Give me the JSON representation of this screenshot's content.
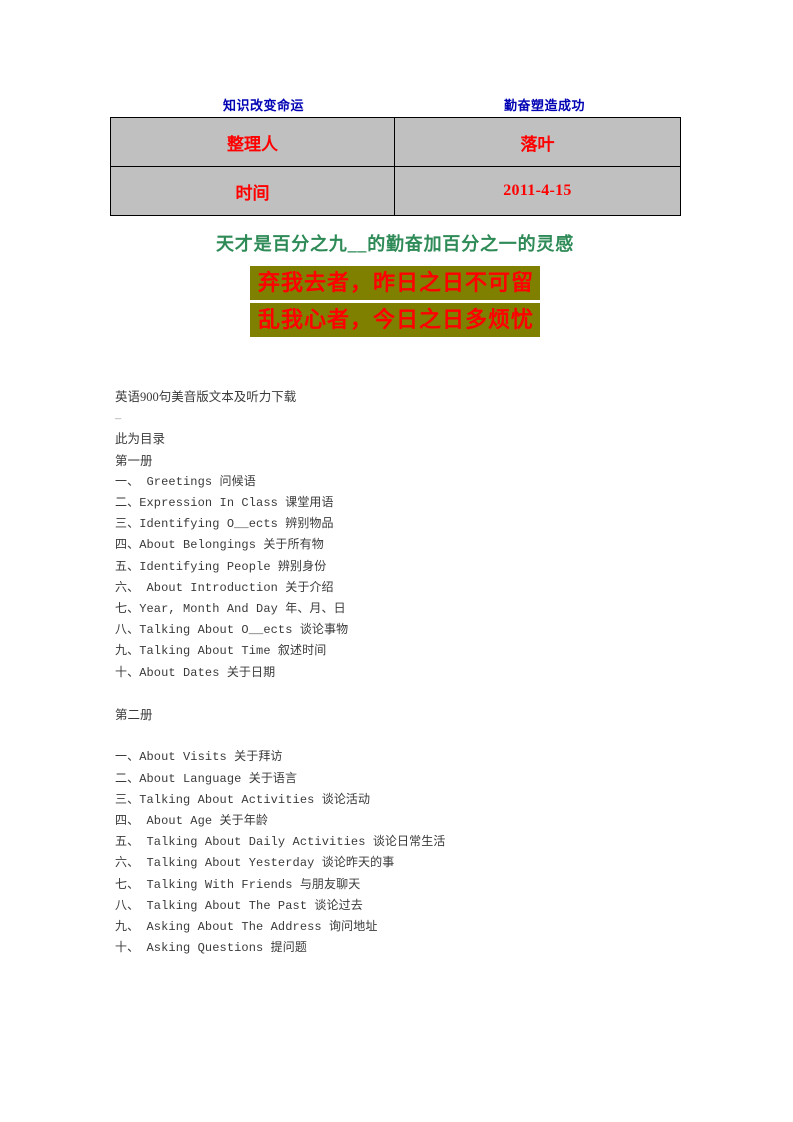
{
  "motto": {
    "left": "知识改变命运",
    "right": "勤奋塑造成功",
    "color": "#0000b4"
  },
  "info_table": {
    "fill_color": "#c0c0c0",
    "text_color": "#ff0000",
    "rows": [
      {
        "label": "整理人",
        "value": "落叶"
      },
      {
        "label": "时间",
        "value": "2011-4-15"
      }
    ]
  },
  "green_quote": {
    "text": "天才是百分之九__的勤奋加百分之一的灵感",
    "color": "#2e8b57"
  },
  "poem": {
    "highlight_color": "#808000",
    "text_color": "#ff0000",
    "lines": [
      "弃我去者，昨日之日不可留",
      "乱我心者，今日之日多烦忧"
    ]
  },
  "body": {
    "title": "英语900句美音版文本及听力下载",
    "dash": "–",
    "intro": "此为目录",
    "volume_one": {
      "heading": "第一册",
      "items": [
        "一、 Greetings 问候语",
        "二、Expression In Class 课堂用语",
        "三、Identifying O__ects 辨别物品",
        "四、About Belongings 关于所有物",
        "五、Identifying People 辨别身份",
        "六、 About Introduction 关于介绍",
        "七、Year, Month And Day 年、月、日",
        "八、Talking About O__ects 谈论事物",
        "九、Talking About Time 叙述时间",
        "十、About Dates 关于日期"
      ]
    },
    "volume_two": {
      "heading": "第二册",
      "items": [
        "一、About Visits 关于拜访",
        "二、About Language 关于语言",
        "三、Talking About Activities 谈论活动",
        "四、 About Age 关于年龄",
        "五、 Talking About Daily Activities 谈论日常生活",
        "六、 Talking About Yesterday 谈论昨天的事",
        "七、 Talking With Friends 与朋友聊天",
        "八、 Talking About The Past 谈论过去",
        "九、 Asking About The Address 询问地址",
        "十、 Asking Questions 提问题"
      ]
    }
  }
}
